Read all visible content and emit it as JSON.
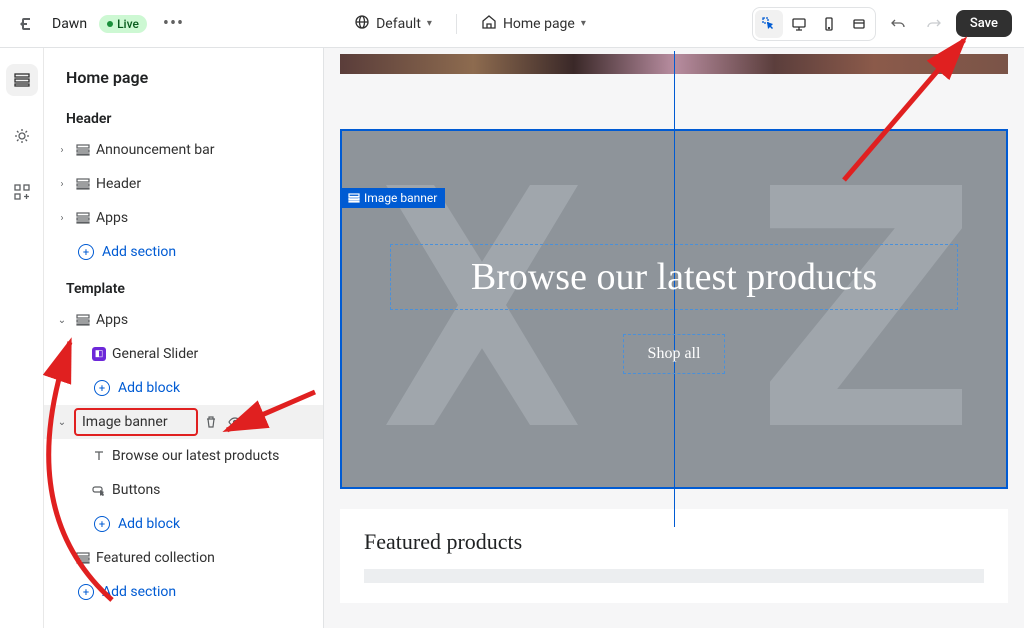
{
  "topbar": {
    "theme_name": "Dawn",
    "live_label": "Live",
    "default_label": "Default",
    "page_label": "Home page",
    "save_label": "Save"
  },
  "sidebar": {
    "title": "Home page",
    "groups": {
      "header": {
        "label": "Header",
        "items": [
          {
            "label": "Announcement bar"
          },
          {
            "label": "Header"
          },
          {
            "label": "Apps"
          }
        ],
        "add_label": "Add section"
      },
      "template": {
        "label": "Template",
        "apps": {
          "label": "Apps",
          "children": [
            {
              "label": "General Slider"
            }
          ],
          "add_label": "Add block"
        },
        "image_banner": {
          "label": "Image banner",
          "children": [
            {
              "label": "Browse our latest products"
            },
            {
              "label": "Buttons"
            }
          ],
          "add_label": "Add block"
        },
        "featured_collection": {
          "label": "Featured collection"
        },
        "add_label": "Add section"
      }
    }
  },
  "preview": {
    "section_tag": "Image banner",
    "banner_heading": "Browse our latest products",
    "banner_button": "Shop all",
    "featured_title": "Featured products"
  }
}
